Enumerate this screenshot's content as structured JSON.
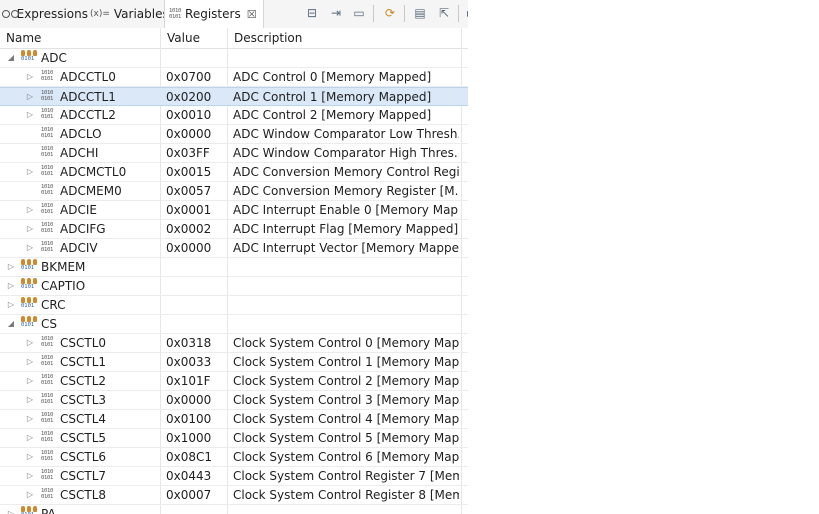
{
  "tabs": [
    {
      "label": "Expressions",
      "icon": "glasses-icon"
    },
    {
      "label": "Variables",
      "icon_text": "(x)="
    },
    {
      "label": "Registers",
      "icon": "binary-icon",
      "close": "☒"
    }
  ],
  "columns": {
    "name": "Name",
    "value": "Value",
    "description": "Description"
  },
  "toolbar": [
    "collapse-all-icon",
    "link-icon",
    "minimize-icon",
    "refresh-icon",
    "new-group-icon",
    "export-icon",
    "more-icon"
  ],
  "rows": [
    {
      "name": "ADC",
      "value": "",
      "desc": "",
      "level": 0,
      "kind": "group",
      "twisty": "expanded"
    },
    {
      "name": "ADCCTL0",
      "value": "0x0700",
      "desc": "ADC Control 0 [Memory Mapped]",
      "level": 1,
      "kind": "reg",
      "twisty": "collapsed"
    },
    {
      "name": "ADCCTL1",
      "value": "0x0200",
      "desc": "ADC Control 1 [Memory Mapped]",
      "level": 1,
      "kind": "reg",
      "twisty": "collapsed",
      "selected": true
    },
    {
      "name": "ADCCTL2",
      "value": "0x0010",
      "desc": "ADC Control 2 [Memory Mapped]",
      "level": 1,
      "kind": "reg",
      "twisty": "collapsed"
    },
    {
      "name": "ADCLO",
      "value": "0x0000",
      "desc": "ADC Window Comparator Low Thresh...",
      "level": 1,
      "kind": "reg",
      "twisty": "none"
    },
    {
      "name": "ADCHI",
      "value": "0x03FF",
      "desc": "ADC Window Comparator High Thres...",
      "level": 1,
      "kind": "reg",
      "twisty": "none"
    },
    {
      "name": "ADCMCTL0",
      "value": "0x0015",
      "desc": "ADC Conversion Memory Control Regi...",
      "level": 1,
      "kind": "reg",
      "twisty": "collapsed"
    },
    {
      "name": "ADCMEM0",
      "value": "0x0057",
      "desc": "ADC Conversion Memory Register [M...",
      "level": 1,
      "kind": "reg",
      "twisty": "none"
    },
    {
      "name": "ADCIE",
      "value": "0x0001",
      "desc": "ADC Interrupt Enable 0 [Memory Map...",
      "level": 1,
      "kind": "reg",
      "twisty": "collapsed"
    },
    {
      "name": "ADCIFG",
      "value": "0x0002",
      "desc": "ADC Interrupt Flag [Memory Mapped]",
      "level": 1,
      "kind": "reg",
      "twisty": "collapsed"
    },
    {
      "name": "ADCIV",
      "value": "0x0000",
      "desc": "ADC Interrupt Vector [Memory Mappe...",
      "level": 1,
      "kind": "reg",
      "twisty": "collapsed"
    },
    {
      "name": "BKMEM",
      "value": "",
      "desc": "",
      "level": 0,
      "kind": "group",
      "twisty": "collapsed"
    },
    {
      "name": "CAPTIO",
      "value": "",
      "desc": "",
      "level": 0,
      "kind": "group",
      "twisty": "collapsed"
    },
    {
      "name": "CRC",
      "value": "",
      "desc": "",
      "level": 0,
      "kind": "group",
      "twisty": "collapsed"
    },
    {
      "name": "CS",
      "value": "",
      "desc": "",
      "level": 0,
      "kind": "group",
      "twisty": "expanded"
    },
    {
      "name": "CSCTL0",
      "value": "0x0318",
      "desc": "Clock System Control 0 [Memory Map...",
      "level": 1,
      "kind": "reg",
      "twisty": "collapsed"
    },
    {
      "name": "CSCTL1",
      "value": "0x0033",
      "desc": "Clock System Control 1 [Memory Map...",
      "level": 1,
      "kind": "reg",
      "twisty": "collapsed"
    },
    {
      "name": "CSCTL2",
      "value": "0x101F",
      "desc": "Clock System Control 2 [Memory Map...",
      "level": 1,
      "kind": "reg",
      "twisty": "collapsed"
    },
    {
      "name": "CSCTL3",
      "value": "0x0000",
      "desc": "Clock System Control 3 [Memory Map...",
      "level": 1,
      "kind": "reg",
      "twisty": "collapsed"
    },
    {
      "name": "CSCTL4",
      "value": "0x0100",
      "desc": "Clock System Control 4 [Memory Map...",
      "level": 1,
      "kind": "reg",
      "twisty": "collapsed"
    },
    {
      "name": "CSCTL5",
      "value": "0x1000",
      "desc": "Clock System Control 5 [Memory Map...",
      "level": 1,
      "kind": "reg",
      "twisty": "collapsed"
    },
    {
      "name": "CSCTL6",
      "value": "0x08C1",
      "desc": "Clock System Control 6 [Memory Map...",
      "level": 1,
      "kind": "reg",
      "twisty": "collapsed"
    },
    {
      "name": "CSCTL7",
      "value": "0x0443",
      "desc": "Clock System Control Register 7 [Mem...",
      "level": 1,
      "kind": "reg",
      "twisty": "collapsed"
    },
    {
      "name": "CSCTL8",
      "value": "0x0007",
      "desc": "Clock System Control Register 8 [Mem...",
      "level": 1,
      "kind": "reg",
      "twisty": "collapsed"
    },
    {
      "name": "PA",
      "value": "",
      "desc": "",
      "level": 0,
      "kind": "group",
      "twisty": "collapsed"
    }
  ]
}
